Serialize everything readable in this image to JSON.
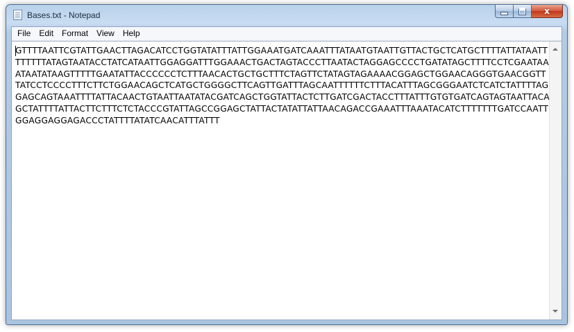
{
  "window": {
    "title": "Bases.txt - Notepad",
    "icon": "notepad-icon",
    "controls": {
      "minimize_icon": "minimize-icon",
      "maximize_icon": "maximize-icon",
      "close_glyph": "x"
    }
  },
  "menu": {
    "items": [
      {
        "label": "File"
      },
      {
        "label": "Edit"
      },
      {
        "label": "Format"
      },
      {
        "label": "View"
      },
      {
        "label": "Help"
      }
    ]
  },
  "editor": {
    "content": "GTTTTAATTCGTATTGAACTTAGACATCCTGGTATATTTATTGGAAATGATCAAATTTATAATGTAATTGTTACTGCTCATGCTTTTATTATAATTTTTTTTATAGTAATACCTATCATAATTGGAGGATTTGGAAACTGACTAGTACCCTTAATACTAGGAGCCCCTGATATAGCTTTTCCTCGAATAAATAATATAAGTTTTTGAATATTACCCCCCTCTTTAACACTGCTGCTTTCTAGTTCTATAGTAGAAAACGGAGCTGGAACAGGGTGAACGGTTTATCCTCCCCTTTCTTCTGGAACAGCTCATGCTGGGGCTTCAGTTGATTTAGCAATTTTTTCTTTACATTTAGCGGGAATCTCATCTATTTTAGGAGCAGTAAATTTTATTACAACTGTAATTAATATACGATCAGCTGGTATTACTCTTGATCGACTACCTTTATTTGTGTGATCAGTAGTAATTACAGCTATTTTATTACTTCTTTCTCTACCCGTATTAGCCGGAGCTATTACTATATTATTAACAGACCGAAATTTAAATACATCTTTTTTTGATCCAATTGGAGGAGGAGACCCTATTTTATATCAACATTTATTT"
  },
  "colors": {
    "title_bar": "#b9d1ea",
    "close_button": "#c8432a",
    "text": "#000000",
    "background": "#ffffff"
  }
}
